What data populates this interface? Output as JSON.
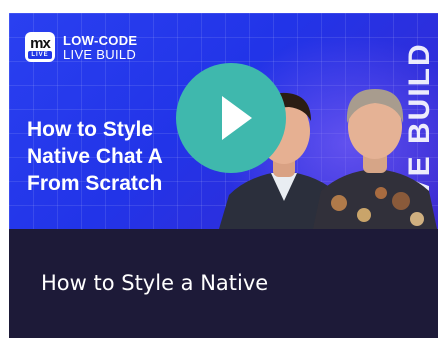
{
  "thumbnail": {
    "logo": {
      "mark": "mx",
      "badge": "LIVE"
    },
    "brand": {
      "line1": "LOW-CODE",
      "line2": "LIVE BUILD"
    },
    "headline_lines": [
      "How to Style",
      "Native Chat A",
      "From Scratch"
    ],
    "vertical_text": "LIVE BUILD",
    "play_button_icon": "play-icon",
    "colors": {
      "background": "#2236e6",
      "play_button": "#3fb8ad",
      "caption_background": "#1d1a38"
    }
  },
  "caption": {
    "title": "How to Style a Native"
  }
}
